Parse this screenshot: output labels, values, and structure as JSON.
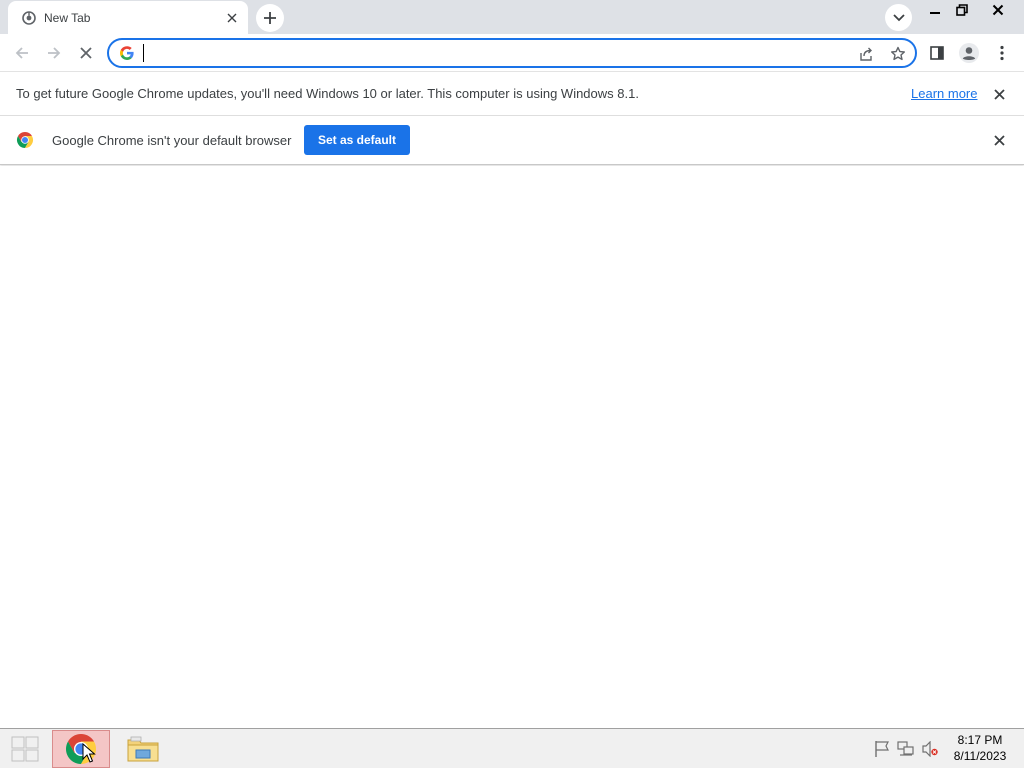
{
  "browser": {
    "tab": {
      "title": "New Tab",
      "favicon": "chrome-newtab-icon"
    },
    "controls": {
      "new_tab": "plus-icon",
      "tab_search": "chevron-down-icon",
      "minimize": "minimize-icon",
      "restore": "restore-icon",
      "close": "close-icon"
    }
  },
  "toolbar": {
    "back": "arrow-left-icon",
    "forward": "arrow-right-icon",
    "stop": "close-icon",
    "omnibox": {
      "value": "",
      "placeholder": ""
    },
    "share": "share-icon",
    "bookmark": "star-icon",
    "side_panel": "side-panel-icon",
    "profile": "profile-icon",
    "menu": "kebab-menu-icon"
  },
  "infobars": {
    "update": {
      "text": "To get future Google Chrome updates, you'll need Windows 10 or later. This computer is using Windows 8.1.",
      "link": "Learn more"
    },
    "default_browser": {
      "text": "Google Chrome isn't your default browser",
      "button": "Set as default"
    }
  },
  "taskbar": {
    "apps": [
      "chrome",
      "file-explorer"
    ],
    "clock": {
      "time": "8:17 PM",
      "date": "8/11/2023"
    }
  },
  "colors": {
    "accent": "#1a73e8",
    "tabstrip": "#dee1e6",
    "taskbar": "#f0f0f0",
    "active_task": "#f4c6c6"
  }
}
